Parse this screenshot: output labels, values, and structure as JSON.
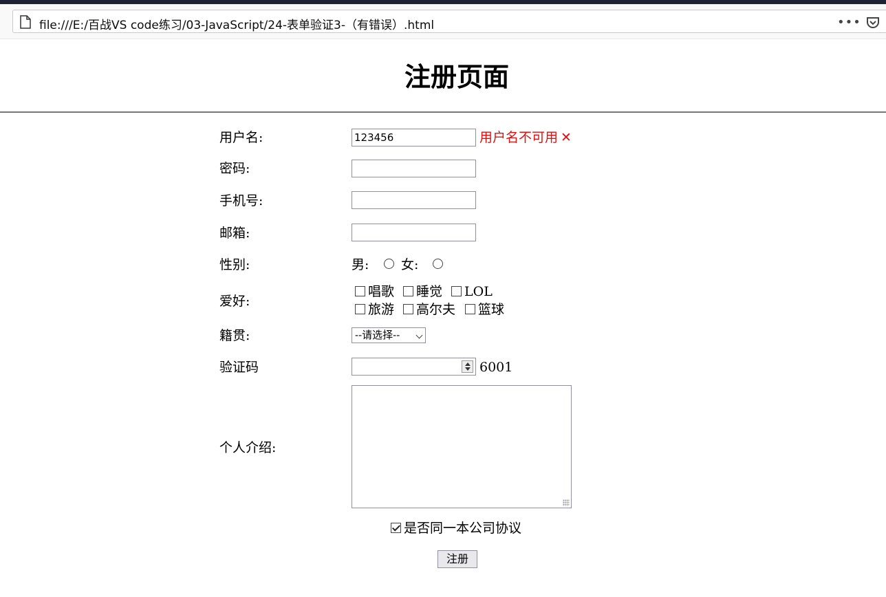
{
  "browser": {
    "url": "file:///E:/百战VS code练习/03-JavaScript/24-表单验证3-（有错误）.html",
    "more_icon": "•••",
    "star_icon": "☆"
  },
  "page": {
    "title": "注册页面"
  },
  "form": {
    "username": {
      "label": "用户名:",
      "value": "123456",
      "error": "用户名不可用",
      "error_icon": "✕"
    },
    "password": {
      "label": "密码:",
      "value": ""
    },
    "phone": {
      "label": "手机号:",
      "value": ""
    },
    "email": {
      "label": "邮箱:",
      "value": ""
    },
    "gender": {
      "label": "性别:",
      "options": [
        "男:",
        "女:"
      ]
    },
    "hobbies": {
      "label": "爱好:",
      "options": [
        "唱歌",
        "睡觉",
        "LOL",
        "旅游",
        "高尔夫",
        "篮球"
      ]
    },
    "hometown": {
      "label": "籍贯:",
      "selected": "--请选择--"
    },
    "captcha": {
      "label": "验证码",
      "value": "",
      "code": "6001"
    },
    "bio": {
      "label": "个人介绍:",
      "value": ""
    },
    "agreement": {
      "label": "是否同一本公司协议",
      "checked": true
    },
    "submit_label": "注册"
  }
}
